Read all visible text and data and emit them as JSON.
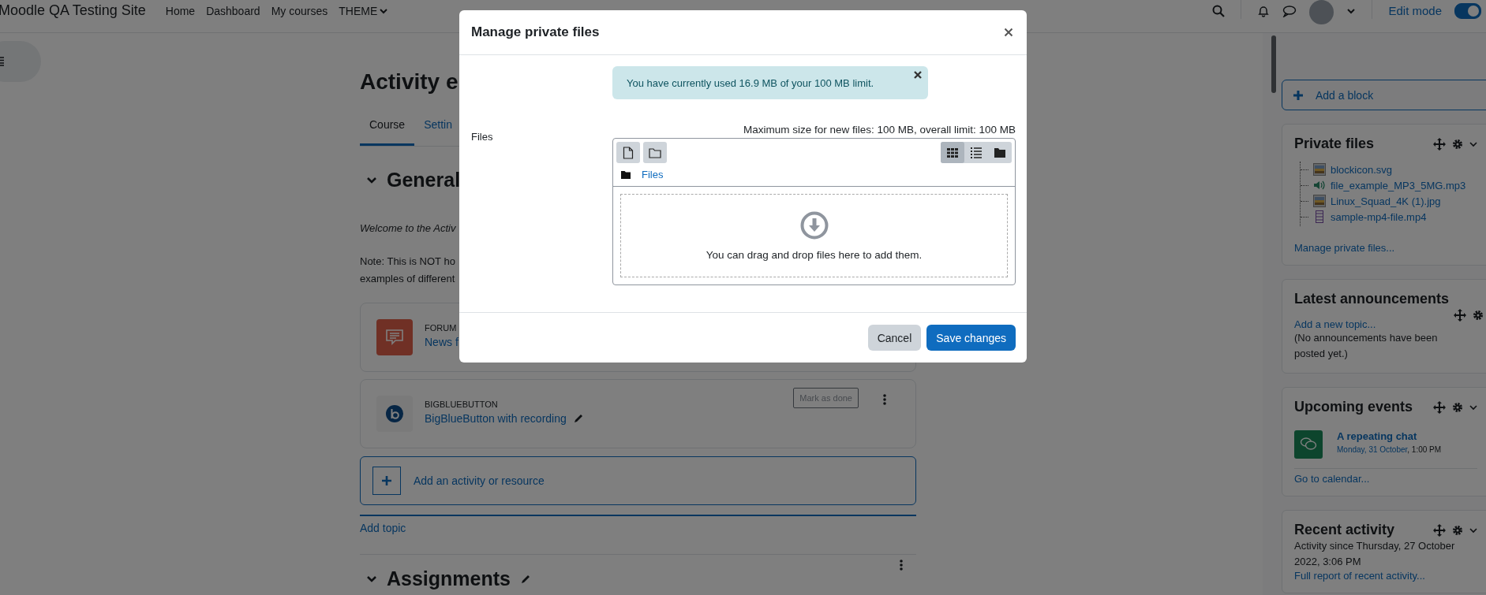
{
  "navbar": {
    "site_name": "Moodle QA Testing Site",
    "links": [
      {
        "label": "Home",
        "kind": "link"
      },
      {
        "label": "Dashboard",
        "kind": "link"
      },
      {
        "label": "My courses",
        "kind": "link"
      },
      {
        "label": "THEME",
        "kind": "dropdown"
      }
    ],
    "edit_mode": {
      "label": "Edit mode",
      "on": true
    }
  },
  "course": {
    "title": "Activity e",
    "tabs": [
      {
        "label": "Course",
        "selected": true
      },
      {
        "label": "Settin",
        "selected": false
      }
    ],
    "sections": [
      {
        "title": "General",
        "expanded": true,
        "summary": [
          {
            "text": "Welcome to the Activ",
            "kind": "italic"
          },
          {
            "text": "Note: This is NOT ho",
            "kind": "plain"
          },
          {
            "text": "examples of different",
            "kind": "plain"
          }
        ],
        "activities": [
          {
            "kind": "forum",
            "type": "FORUM",
            "name": "News f"
          },
          {
            "kind": "bigbluebutton",
            "type": "BIGBLUEBUTTON",
            "name": "BigBlueButton with recording",
            "completion": "Mark as done"
          }
        ],
        "add_activity": "Add an activity or resource"
      }
    ],
    "add_topic": "Add topic",
    "next_section": {
      "title": "Assignments",
      "expanded": true
    }
  },
  "sidebar": {
    "add_block": "Add a block",
    "blocks": [
      {
        "kind": "files",
        "title": "Private files",
        "files": [
          {
            "name": "blockicon.svg",
            "kind": "image"
          },
          {
            "name": "file_example_MP3_5MG.mp3",
            "kind": "audio"
          },
          {
            "name": "Linux_Squad_4K (1).jpg",
            "kind": "image"
          },
          {
            "name": "sample-mp4-file.mp4",
            "kind": "video"
          }
        ],
        "link": "Manage private files..."
      },
      {
        "kind": "announcements",
        "title": "Latest announcements",
        "link": "Add a new topic...",
        "text": "(No announcements have been posted yet.)"
      },
      {
        "kind": "events",
        "title": "Upcoming events",
        "event": {
          "name": "A repeating chat",
          "date": "Monday, 31 October",
          "time": ", 1:00 PM"
        },
        "link": "Go to calendar..."
      },
      {
        "kind": "recent",
        "title": "Recent activity",
        "text": "Activity since Thursday, 27 October 2022, 3:06 PM",
        "link": "Full report of recent activity..."
      }
    ]
  },
  "modal": {
    "title": "Manage private files",
    "alert": "You have currently used 16.9 MB of your 100 MB limit.",
    "field_label": "Files",
    "limits": "Maximum size for new files: 100 MB, overall limit: 100 MB",
    "view_modes": [
      {
        "kind": "icons",
        "selected": true
      },
      {
        "kind": "list",
        "selected": false
      },
      {
        "kind": "tree",
        "selected": false
      }
    ],
    "path": "Files",
    "dropzone": "You can drag and drop files here to add them.",
    "buttons": [
      {
        "label": "Cancel",
        "kind": "secondary"
      },
      {
        "label": "Save changes",
        "kind": "primary"
      }
    ]
  }
}
